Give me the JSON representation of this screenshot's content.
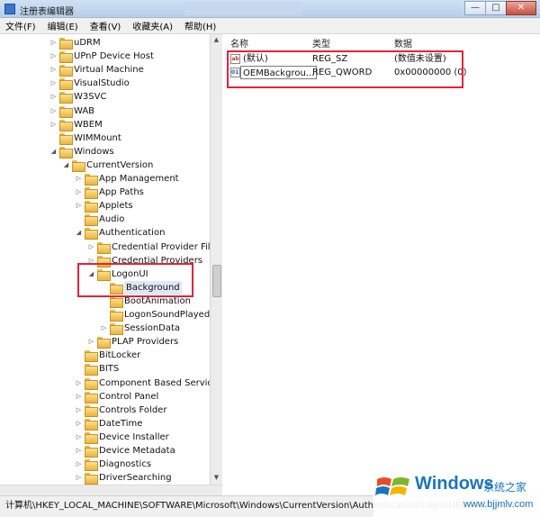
{
  "window": {
    "title": "注册表编辑器",
    "buttons": {
      "minimize": "—",
      "maximize": "□",
      "close": "✕"
    }
  },
  "menu": [
    "文件(F)",
    "编辑(E)",
    "查看(V)",
    "收藏夹(A)",
    "帮助(H)"
  ],
  "tree": {
    "items": [
      {
        "label": "uDRM",
        "depth": 3,
        "expander": "▷"
      },
      {
        "label": "UPnP Device Host",
        "depth": 3,
        "expander": "▷"
      },
      {
        "label": "Virtual Machine",
        "depth": 3,
        "expander": "▷"
      },
      {
        "label": "VisualStudio",
        "depth": 3,
        "expander": "▷"
      },
      {
        "label": "W3SVC",
        "depth": 3,
        "expander": "▷"
      },
      {
        "label": "WAB",
        "depth": 3,
        "expander": "▷"
      },
      {
        "label": "WBEM",
        "depth": 3,
        "expander": "▷"
      },
      {
        "label": "WIMMount",
        "depth": 3,
        "expander": ""
      },
      {
        "label": "Windows",
        "depth": 3,
        "expander": "◢"
      },
      {
        "label": "CurrentVersion",
        "depth": 4,
        "expander": "◢"
      },
      {
        "label": "App Management",
        "depth": 5,
        "expander": "▷"
      },
      {
        "label": "App Paths",
        "depth": 5,
        "expander": "▷"
      },
      {
        "label": "Applets",
        "depth": 5,
        "expander": "▷"
      },
      {
        "label": "Audio",
        "depth": 5,
        "expander": ""
      },
      {
        "label": "Authentication",
        "depth": 5,
        "expander": "◢"
      },
      {
        "label": "Credential Provider Filter",
        "depth": 6,
        "expander": "▷"
      },
      {
        "label": "Credential Providers",
        "depth": 6,
        "expander": "▷"
      },
      {
        "label": "LogonUI",
        "depth": 6,
        "expander": "◢"
      },
      {
        "label": "Background",
        "depth": 7,
        "expander": "",
        "selected": true
      },
      {
        "label": "BootAnimation",
        "depth": 7,
        "expander": ""
      },
      {
        "label": "LogonSoundPlayed",
        "depth": 7,
        "expander": ""
      },
      {
        "label": "SessionData",
        "depth": 7,
        "expander": "▷"
      },
      {
        "label": "PLAP Providers",
        "depth": 6,
        "expander": "▷"
      },
      {
        "label": "BitLocker",
        "depth": 5,
        "expander": ""
      },
      {
        "label": "BITS",
        "depth": 5,
        "expander": ""
      },
      {
        "label": "Component Based Servicing",
        "depth": 5,
        "expander": "▷"
      },
      {
        "label": "Control Panel",
        "depth": 5,
        "expander": "▷"
      },
      {
        "label": "Controls Folder",
        "depth": 5,
        "expander": "▷"
      },
      {
        "label": "DateTime",
        "depth": 5,
        "expander": "▷"
      },
      {
        "label": "Device Installer",
        "depth": 5,
        "expander": "▷"
      },
      {
        "label": "Device Metadata",
        "depth": 5,
        "expander": "▷"
      },
      {
        "label": "Diagnostics",
        "depth": 5,
        "expander": "▷"
      },
      {
        "label": "DriverSearching",
        "depth": 5,
        "expander": "▷"
      }
    ]
  },
  "list": {
    "columns": [
      "名称",
      "类型",
      "数据"
    ],
    "rows": [
      {
        "icon": "ab",
        "icon_kind": "string-value-icon",
        "name": "(默认)",
        "type": "REG_SZ",
        "data": "(数值未设置)",
        "editing": false
      },
      {
        "icon": "011",
        "icon_kind": "binary-value-icon",
        "name": "OEMBackgrou...",
        "type": "REG_QWORD",
        "data": "0x00000000 (0)",
        "editing": true
      }
    ]
  },
  "statusbar": {
    "path": "计算机\\HKEY_LOCAL_MACHINE\\SOFTWARE\\Microsoft\\Windows\\CurrentVersion\\Authentication\\LogonUI\\Background"
  },
  "watermark": {
    "brand": "Windows",
    "sub": "系统之家",
    "url": "www.bjjmlv.com"
  },
  "colors": {
    "highlight": "#e0243a",
    "folder": "#f3c95c",
    "brand": "#1b75bc"
  }
}
